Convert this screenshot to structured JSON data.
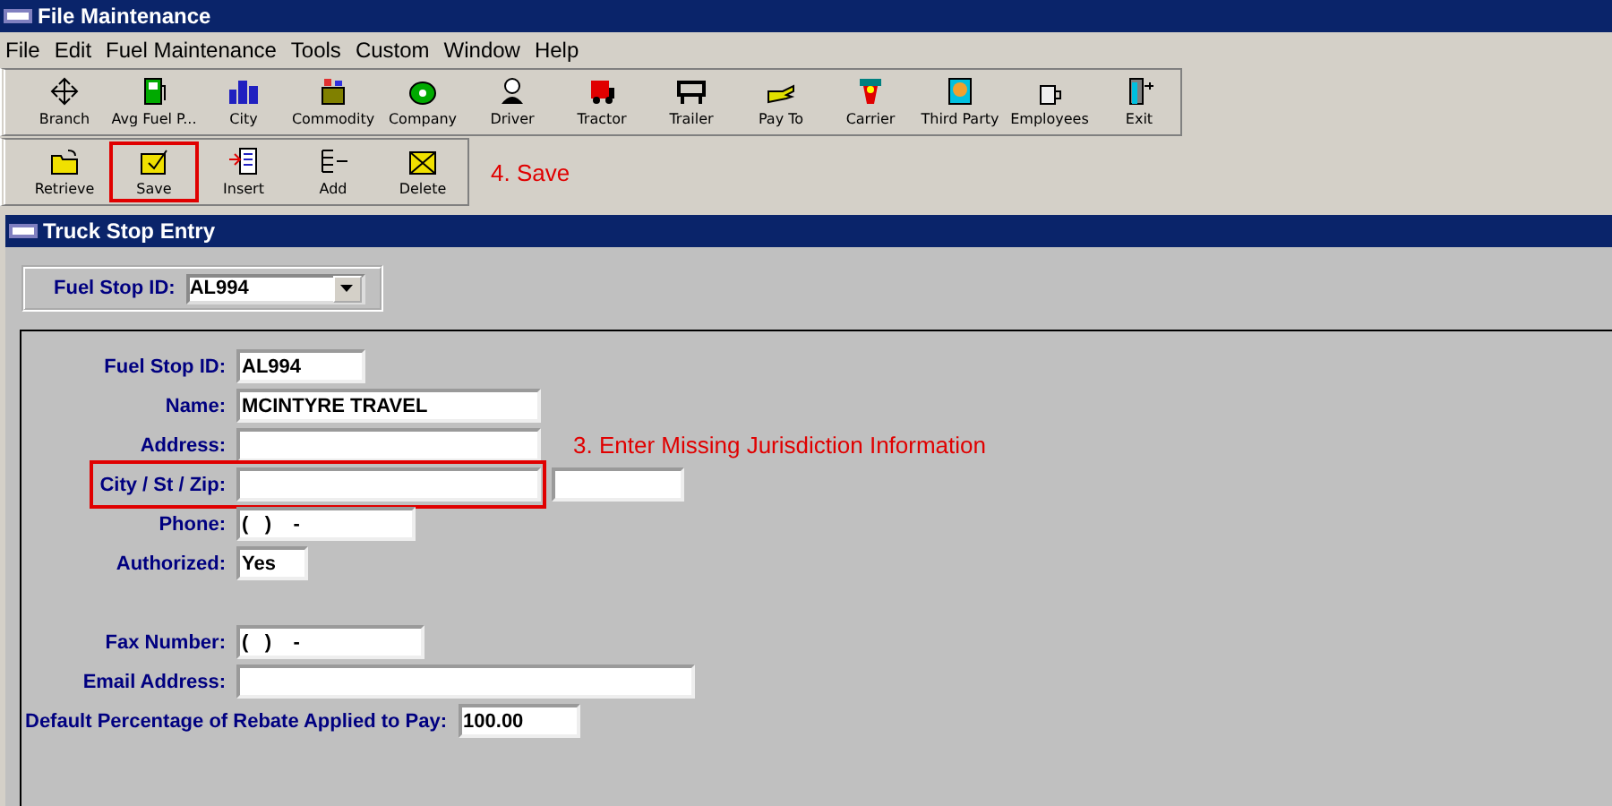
{
  "window": {
    "title": "File Maintenance"
  },
  "menu": [
    "File",
    "Edit",
    "Fuel Maintenance",
    "Tools",
    "Custom",
    "Window",
    "Help"
  ],
  "toolbar": [
    {
      "label": "Branch"
    },
    {
      "label": "Avg Fuel P..."
    },
    {
      "label": "City"
    },
    {
      "label": "Commodity"
    },
    {
      "label": "Company"
    },
    {
      "label": "Driver"
    },
    {
      "label": "Tractor"
    },
    {
      "label": "Trailer"
    },
    {
      "label": "Pay To"
    },
    {
      "label": "Carrier"
    },
    {
      "label": "Third Party"
    },
    {
      "label": "Employees"
    },
    {
      "label": "Exit"
    }
  ],
  "actions": [
    {
      "label": "Retrieve",
      "highlighted": false
    },
    {
      "label": "Save",
      "highlighted": true
    },
    {
      "label": "Insert",
      "highlighted": false
    },
    {
      "label": "Add",
      "highlighted": false
    },
    {
      "label": "Delete",
      "highlighted": false
    }
  ],
  "save_note": "4.  Save",
  "child_window": {
    "title": "Truck Stop Entry"
  },
  "selector": {
    "label": "Fuel Stop ID:",
    "value": "AL994"
  },
  "fields": [
    {
      "label": "Fuel Stop ID:",
      "value": "AL994",
      "highlighted": false
    },
    {
      "label": "Name:",
      "value": "MCINTYRE TRAVEL",
      "highlighted": false
    },
    {
      "label": "Address:",
      "highlighted": false,
      "note": "3.  Enter Missing Jurisdiction Information"
    },
    {
      "label": "City / St / Zip:",
      "highlighted": true
    },
    {
      "label": "Phone:",
      "value": "(   )    -",
      "highlighted": false
    },
    {
      "label": "Authorized:",
      "value": "Yes",
      "highlighted": false
    },
    {
      "label": "Fax Number:",
      "value": "(   )    -",
      "highlighted": false
    },
    {
      "label": "Email Address:",
      "highlighted": false
    },
    {
      "label": "Default Percentage of Rebate Applied to Pay:",
      "value": "100.00",
      "highlighted": false
    }
  ]
}
